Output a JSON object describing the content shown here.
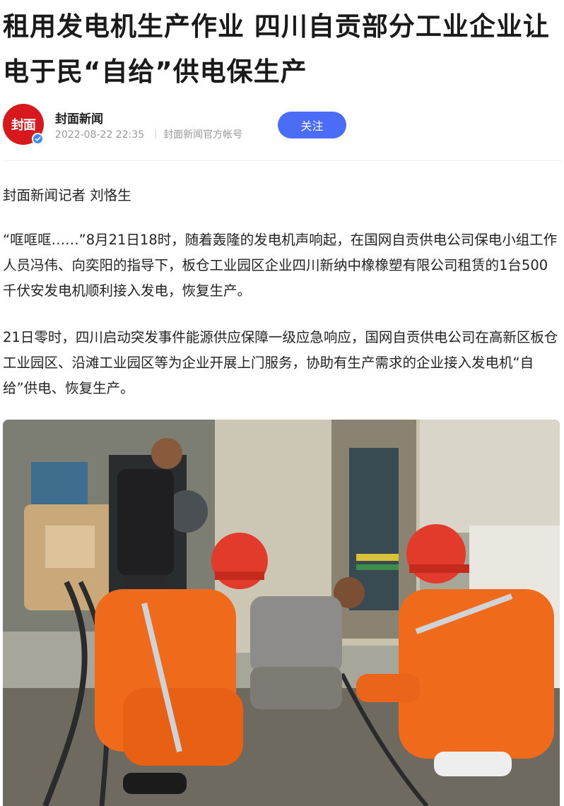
{
  "article": {
    "title": "租用发电机生产作业 四川自贡部分工业企业让电于民“自给”供电保生产"
  },
  "author": {
    "name": "封面新闻",
    "logo_text": "封面",
    "publish_time": "2022-08-22 22:35",
    "account_desc": "封面新闻官方帐号",
    "follow_label": "关注",
    "verified_icon": "check-icon"
  },
  "colors": {
    "follow_button": "#4a6cf7",
    "avatar_bg": "#d7191d",
    "verified_badge": "#3d8bf2"
  },
  "body": {
    "paragraphs": [
      "封面新闻记者 刘恪生",
      "“哐哐哐……”8月21日18时，随着轰隆的发电机声响起，在国网自贡供电公司保电小组工作人员冯伟、向奕阳的指导下，板仓工业园区企业四川新纳中橡橡塑有限公司租赁的1台500千伏安发电机顺利接入发电，恢复生产。",
      "21日零时，四川启动突发事件能源供应保障一级应急响应，国网自贡供电公司在高新区板仓工业园区、沿滩工业园区等为企业开展上门服务，协助有生产需求的企业接入发电机“自给”供电、恢复生产。"
    ]
  }
}
